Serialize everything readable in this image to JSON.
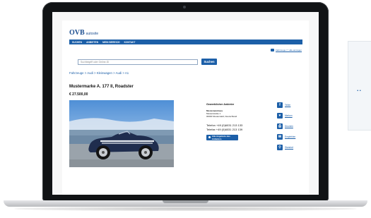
{
  "side_card": {
    "dots": ".."
  },
  "site": {
    "logo": "OVB",
    "logo_sub": "autosite",
    "nav": [
      "SUCHEN",
      "ANBIETEN",
      "MEIN BEREICH",
      "KONTAKT"
    ],
    "watchlist": "Fahrzeuge 7 / alle anzeigen",
    "search": {
      "placeholder": "Suchbegriff oder Online-ID",
      "button": "Suchen"
    },
    "breadcrumb": "Fahrzeuge > Audi > Kleinwagen > Audi > A1",
    "title": "Mustermarke A. 177 II, Roadster",
    "price": "€ 27.500,00",
    "seller": {
      "heading": "Gewerblicher Anbieter",
      "name": "Musterautohaus",
      "street": "Musterstraße 1",
      "city": "00000 Musterstadt, Deutschland",
      "phone1": "Telefon +49 (0)6031 213 133",
      "phone2": "Telefax +49 (0)6031 213 139",
      "all_offers": "Alle Angebote des Anbieters"
    },
    "share": [
      {
        "icon": "facebook-icon",
        "glyph": "f",
        "label": "Teilen"
      },
      {
        "icon": "heart-icon",
        "glyph": "♥",
        "label": "Merken"
      },
      {
        "icon": "printer-icon",
        "glyph": "⎙",
        "label": "Drucken"
      },
      {
        "icon": "mail-icon",
        "glyph": "✉",
        "label": "Empfehlen"
      },
      {
        "icon": "location-icon",
        "glyph": "⚲",
        "label": "Standort"
      }
    ]
  }
}
